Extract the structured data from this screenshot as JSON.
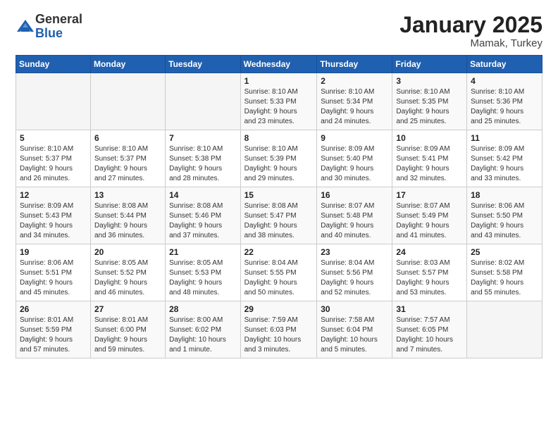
{
  "header": {
    "logo_general": "General",
    "logo_blue": "Blue",
    "month": "January 2025",
    "location": "Mamak, Turkey"
  },
  "weekdays": [
    "Sunday",
    "Monday",
    "Tuesday",
    "Wednesday",
    "Thursday",
    "Friday",
    "Saturday"
  ],
  "weeks": [
    [
      {
        "day": "",
        "info": ""
      },
      {
        "day": "",
        "info": ""
      },
      {
        "day": "",
        "info": ""
      },
      {
        "day": "1",
        "info": "Sunrise: 8:10 AM\nSunset: 5:33 PM\nDaylight: 9 hours\nand 23 minutes."
      },
      {
        "day": "2",
        "info": "Sunrise: 8:10 AM\nSunset: 5:34 PM\nDaylight: 9 hours\nand 24 minutes."
      },
      {
        "day": "3",
        "info": "Sunrise: 8:10 AM\nSunset: 5:35 PM\nDaylight: 9 hours\nand 25 minutes."
      },
      {
        "day": "4",
        "info": "Sunrise: 8:10 AM\nSunset: 5:36 PM\nDaylight: 9 hours\nand 25 minutes."
      }
    ],
    [
      {
        "day": "5",
        "info": "Sunrise: 8:10 AM\nSunset: 5:37 PM\nDaylight: 9 hours\nand 26 minutes."
      },
      {
        "day": "6",
        "info": "Sunrise: 8:10 AM\nSunset: 5:37 PM\nDaylight: 9 hours\nand 27 minutes."
      },
      {
        "day": "7",
        "info": "Sunrise: 8:10 AM\nSunset: 5:38 PM\nDaylight: 9 hours\nand 28 minutes."
      },
      {
        "day": "8",
        "info": "Sunrise: 8:10 AM\nSunset: 5:39 PM\nDaylight: 9 hours\nand 29 minutes."
      },
      {
        "day": "9",
        "info": "Sunrise: 8:09 AM\nSunset: 5:40 PM\nDaylight: 9 hours\nand 30 minutes."
      },
      {
        "day": "10",
        "info": "Sunrise: 8:09 AM\nSunset: 5:41 PM\nDaylight: 9 hours\nand 32 minutes."
      },
      {
        "day": "11",
        "info": "Sunrise: 8:09 AM\nSunset: 5:42 PM\nDaylight: 9 hours\nand 33 minutes."
      }
    ],
    [
      {
        "day": "12",
        "info": "Sunrise: 8:09 AM\nSunset: 5:43 PM\nDaylight: 9 hours\nand 34 minutes."
      },
      {
        "day": "13",
        "info": "Sunrise: 8:08 AM\nSunset: 5:44 PM\nDaylight: 9 hours\nand 36 minutes."
      },
      {
        "day": "14",
        "info": "Sunrise: 8:08 AM\nSunset: 5:46 PM\nDaylight: 9 hours\nand 37 minutes."
      },
      {
        "day": "15",
        "info": "Sunrise: 8:08 AM\nSunset: 5:47 PM\nDaylight: 9 hours\nand 38 minutes."
      },
      {
        "day": "16",
        "info": "Sunrise: 8:07 AM\nSunset: 5:48 PM\nDaylight: 9 hours\nand 40 minutes."
      },
      {
        "day": "17",
        "info": "Sunrise: 8:07 AM\nSunset: 5:49 PM\nDaylight: 9 hours\nand 41 minutes."
      },
      {
        "day": "18",
        "info": "Sunrise: 8:06 AM\nSunset: 5:50 PM\nDaylight: 9 hours\nand 43 minutes."
      }
    ],
    [
      {
        "day": "19",
        "info": "Sunrise: 8:06 AM\nSunset: 5:51 PM\nDaylight: 9 hours\nand 45 minutes."
      },
      {
        "day": "20",
        "info": "Sunrise: 8:05 AM\nSunset: 5:52 PM\nDaylight: 9 hours\nand 46 minutes."
      },
      {
        "day": "21",
        "info": "Sunrise: 8:05 AM\nSunset: 5:53 PM\nDaylight: 9 hours\nand 48 minutes."
      },
      {
        "day": "22",
        "info": "Sunrise: 8:04 AM\nSunset: 5:55 PM\nDaylight: 9 hours\nand 50 minutes."
      },
      {
        "day": "23",
        "info": "Sunrise: 8:04 AM\nSunset: 5:56 PM\nDaylight: 9 hours\nand 52 minutes."
      },
      {
        "day": "24",
        "info": "Sunrise: 8:03 AM\nSunset: 5:57 PM\nDaylight: 9 hours\nand 53 minutes."
      },
      {
        "day": "25",
        "info": "Sunrise: 8:02 AM\nSunset: 5:58 PM\nDaylight: 9 hours\nand 55 minutes."
      }
    ],
    [
      {
        "day": "26",
        "info": "Sunrise: 8:01 AM\nSunset: 5:59 PM\nDaylight: 9 hours\nand 57 minutes."
      },
      {
        "day": "27",
        "info": "Sunrise: 8:01 AM\nSunset: 6:00 PM\nDaylight: 9 hours\nand 59 minutes."
      },
      {
        "day": "28",
        "info": "Sunrise: 8:00 AM\nSunset: 6:02 PM\nDaylight: 10 hours\nand 1 minute."
      },
      {
        "day": "29",
        "info": "Sunrise: 7:59 AM\nSunset: 6:03 PM\nDaylight: 10 hours\nand 3 minutes."
      },
      {
        "day": "30",
        "info": "Sunrise: 7:58 AM\nSunset: 6:04 PM\nDaylight: 10 hours\nand 5 minutes."
      },
      {
        "day": "31",
        "info": "Sunrise: 7:57 AM\nSunset: 6:05 PM\nDaylight: 10 hours\nand 7 minutes."
      },
      {
        "day": "",
        "info": ""
      }
    ]
  ]
}
